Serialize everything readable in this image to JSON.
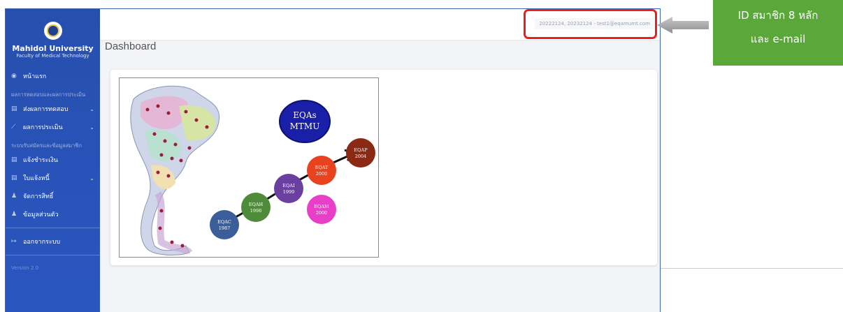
{
  "sidebar": {
    "university": "Mahidol University",
    "faculty": "Faculty of Medical Technology",
    "home": "หน้าแรก",
    "section1": "ผลการทดสอบและผลการประเมิน",
    "submit_results": "ส่งผลการทดสอบ",
    "evaluation": "ผลการประเมิน",
    "section2": "ระบบรับสมัครและข้อมูลสมาชิก",
    "payment": "แจ้งชำระเงิน",
    "invoice": "ใบแจ้งหนี้",
    "rights": "จัดการสิทธิ์",
    "profile": "ข้อมูลส่วนตัว",
    "logout": "ออกจากระบบ",
    "version": "Version 2.0"
  },
  "header": {
    "user_info": "20222124, 20232124 - test1@eqamumt.com"
  },
  "page": {
    "title": "Dashboard"
  },
  "diagram": {
    "eqas_line1": "EQAs",
    "eqas_line2": "MTMU",
    "nodes": [
      {
        "name": "EQAC",
        "year": "1987",
        "color": "#3b5e9a"
      },
      {
        "name": "EQAH",
        "year": "1998",
        "color": "#4f8c3a"
      },
      {
        "name": "EQAI",
        "year": "1999",
        "color": "#6a3fa0"
      },
      {
        "name": "EQAT",
        "year": "2000",
        "color": "#e8421f"
      },
      {
        "name": "EQAP",
        "year": "2004",
        "color": "#8a2a14"
      },
      {
        "name": "EQAM",
        "year": "2000",
        "color": "#e83ec8"
      }
    ]
  },
  "callout": {
    "line1": "ID สมาชิก 8 หลัก",
    "line2": "และ e-mail"
  }
}
